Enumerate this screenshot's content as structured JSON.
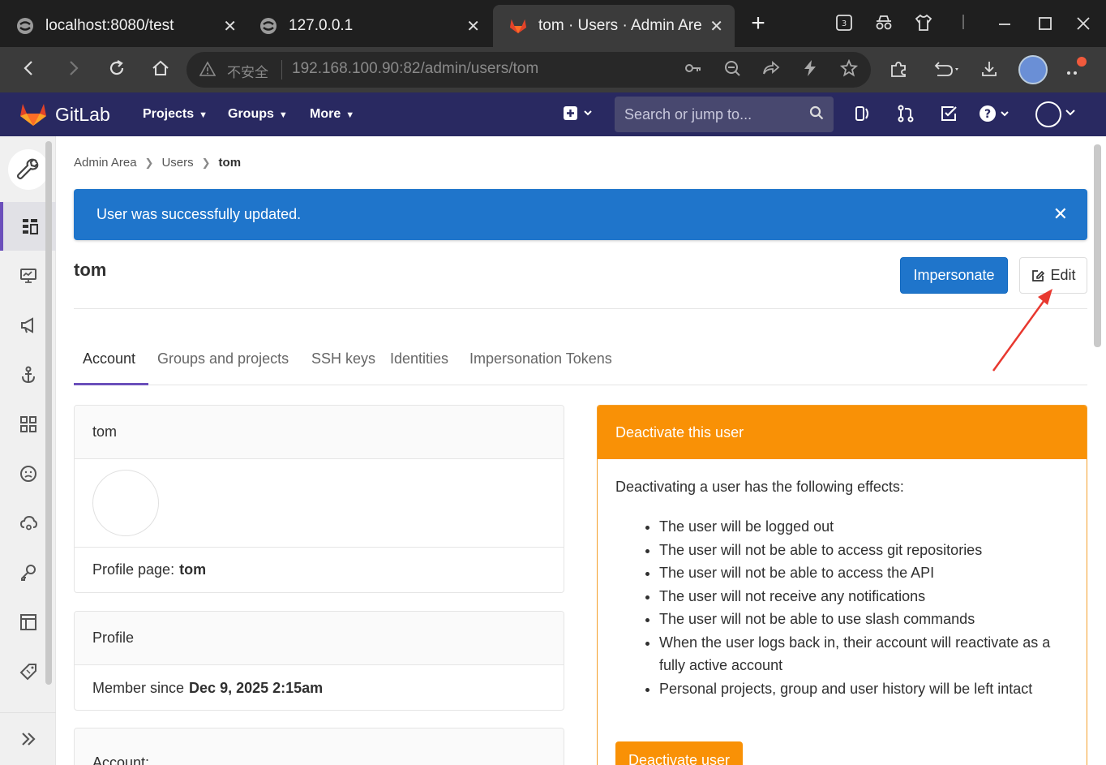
{
  "browser": {
    "tabs": [
      {
        "label": "localhost:8080/test",
        "close": "✕"
      },
      {
        "label": "127.0.0.1",
        "close": "✕"
      },
      {
        "label": "tom · Users · Admin Area",
        "close": "✕"
      }
    ],
    "new_tab": "+",
    "tab_count_badge": "3",
    "address": {
      "security_label": "不安全",
      "url": "192.168.100.90:82/admin/users/tom"
    }
  },
  "gitlab": {
    "brand": "GitLab",
    "nav": [
      {
        "label": "Projects"
      },
      {
        "label": "Groups"
      },
      {
        "label": "More"
      }
    ],
    "search_placeholder": "Search or jump to..."
  },
  "breadcrumb": {
    "items": [
      "Admin Area",
      "Users",
      "tom"
    ]
  },
  "flash": {
    "message": "User was successfully updated.",
    "close": "✕"
  },
  "page": {
    "title": "tom",
    "impersonate_label": "Impersonate",
    "edit_label": "Edit"
  },
  "tabs": [
    {
      "label": "Account"
    },
    {
      "label": "Groups and projects"
    },
    {
      "label": "SSH keys"
    },
    {
      "label": "Identities"
    },
    {
      "label": "Impersonation Tokens"
    }
  ],
  "user_card": {
    "name": "tom",
    "profile_label": "Profile page:",
    "profile_value": "tom"
  },
  "profile_card": {
    "header": "Profile",
    "member_since_label": "Member since",
    "member_since_value": "Dec 9, 2025 2:15am"
  },
  "account_card": {
    "header": "Account:"
  },
  "deactivate": {
    "header": "Deactivate this user",
    "intro": "Deactivating a user has the following effects:",
    "effects": [
      "The user will be logged out",
      "The user will not be able to access git repositories",
      "The user will not be able to access the API",
      "The user will not receive any notifications",
      "The user will not be able to use slash commands",
      "When the user logs back in, their account will reactivate as a fully active account",
      "Personal projects, group and user history will be left intact"
    ],
    "button_label": "Deactivate user"
  },
  "colors": {
    "gitlab_header": "#292961",
    "flash_blue": "#1f75cb",
    "warning_orange": "#f99106",
    "active_tab": "#6b4fbb",
    "annotation_arrow": "#e8382f"
  }
}
